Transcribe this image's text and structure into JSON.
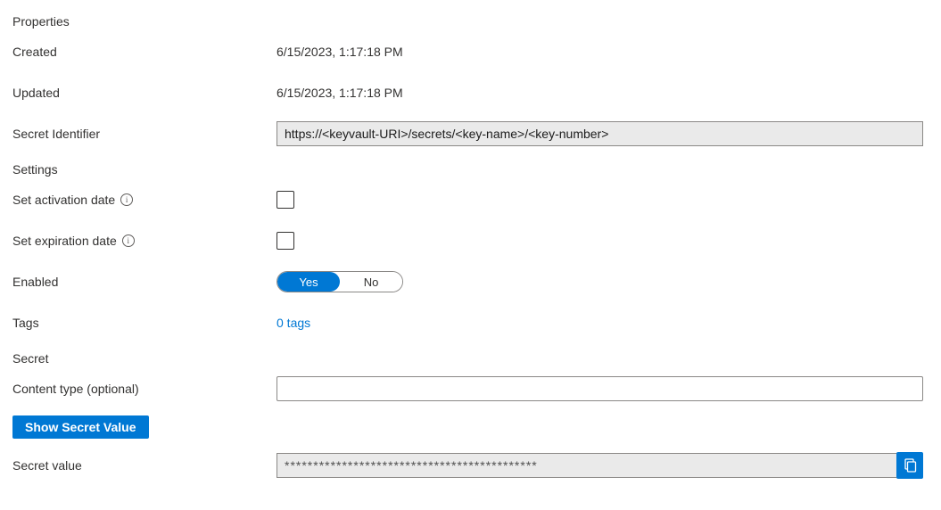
{
  "sections": {
    "properties_header": "Properties",
    "settings_header": "Settings",
    "secret_header": "Secret"
  },
  "properties": {
    "created_label": "Created",
    "created_value": "6/15/2023, 1:17:18 PM",
    "updated_label": "Updated",
    "updated_value": "6/15/2023, 1:17:18 PM",
    "secret_identifier_label": "Secret Identifier",
    "secret_identifier_value": "https://<keyvault-URI>/secrets/<key-name>/<key-number>"
  },
  "settings": {
    "set_activation_label": "Set activation date",
    "set_activation_checked": false,
    "set_expiration_label": "Set expiration date",
    "set_expiration_checked": false,
    "enabled_label": "Enabled",
    "enabled_options": {
      "yes": "Yes",
      "no": "No"
    },
    "enabled_value": "Yes",
    "tags_label": "Tags",
    "tags_link_text": "0 tags"
  },
  "secret": {
    "content_type_label": "Content type (optional)",
    "content_type_value": "",
    "show_secret_button": "Show Secret Value",
    "secret_value_label": "Secret value",
    "secret_value_masked": "********************************************"
  }
}
